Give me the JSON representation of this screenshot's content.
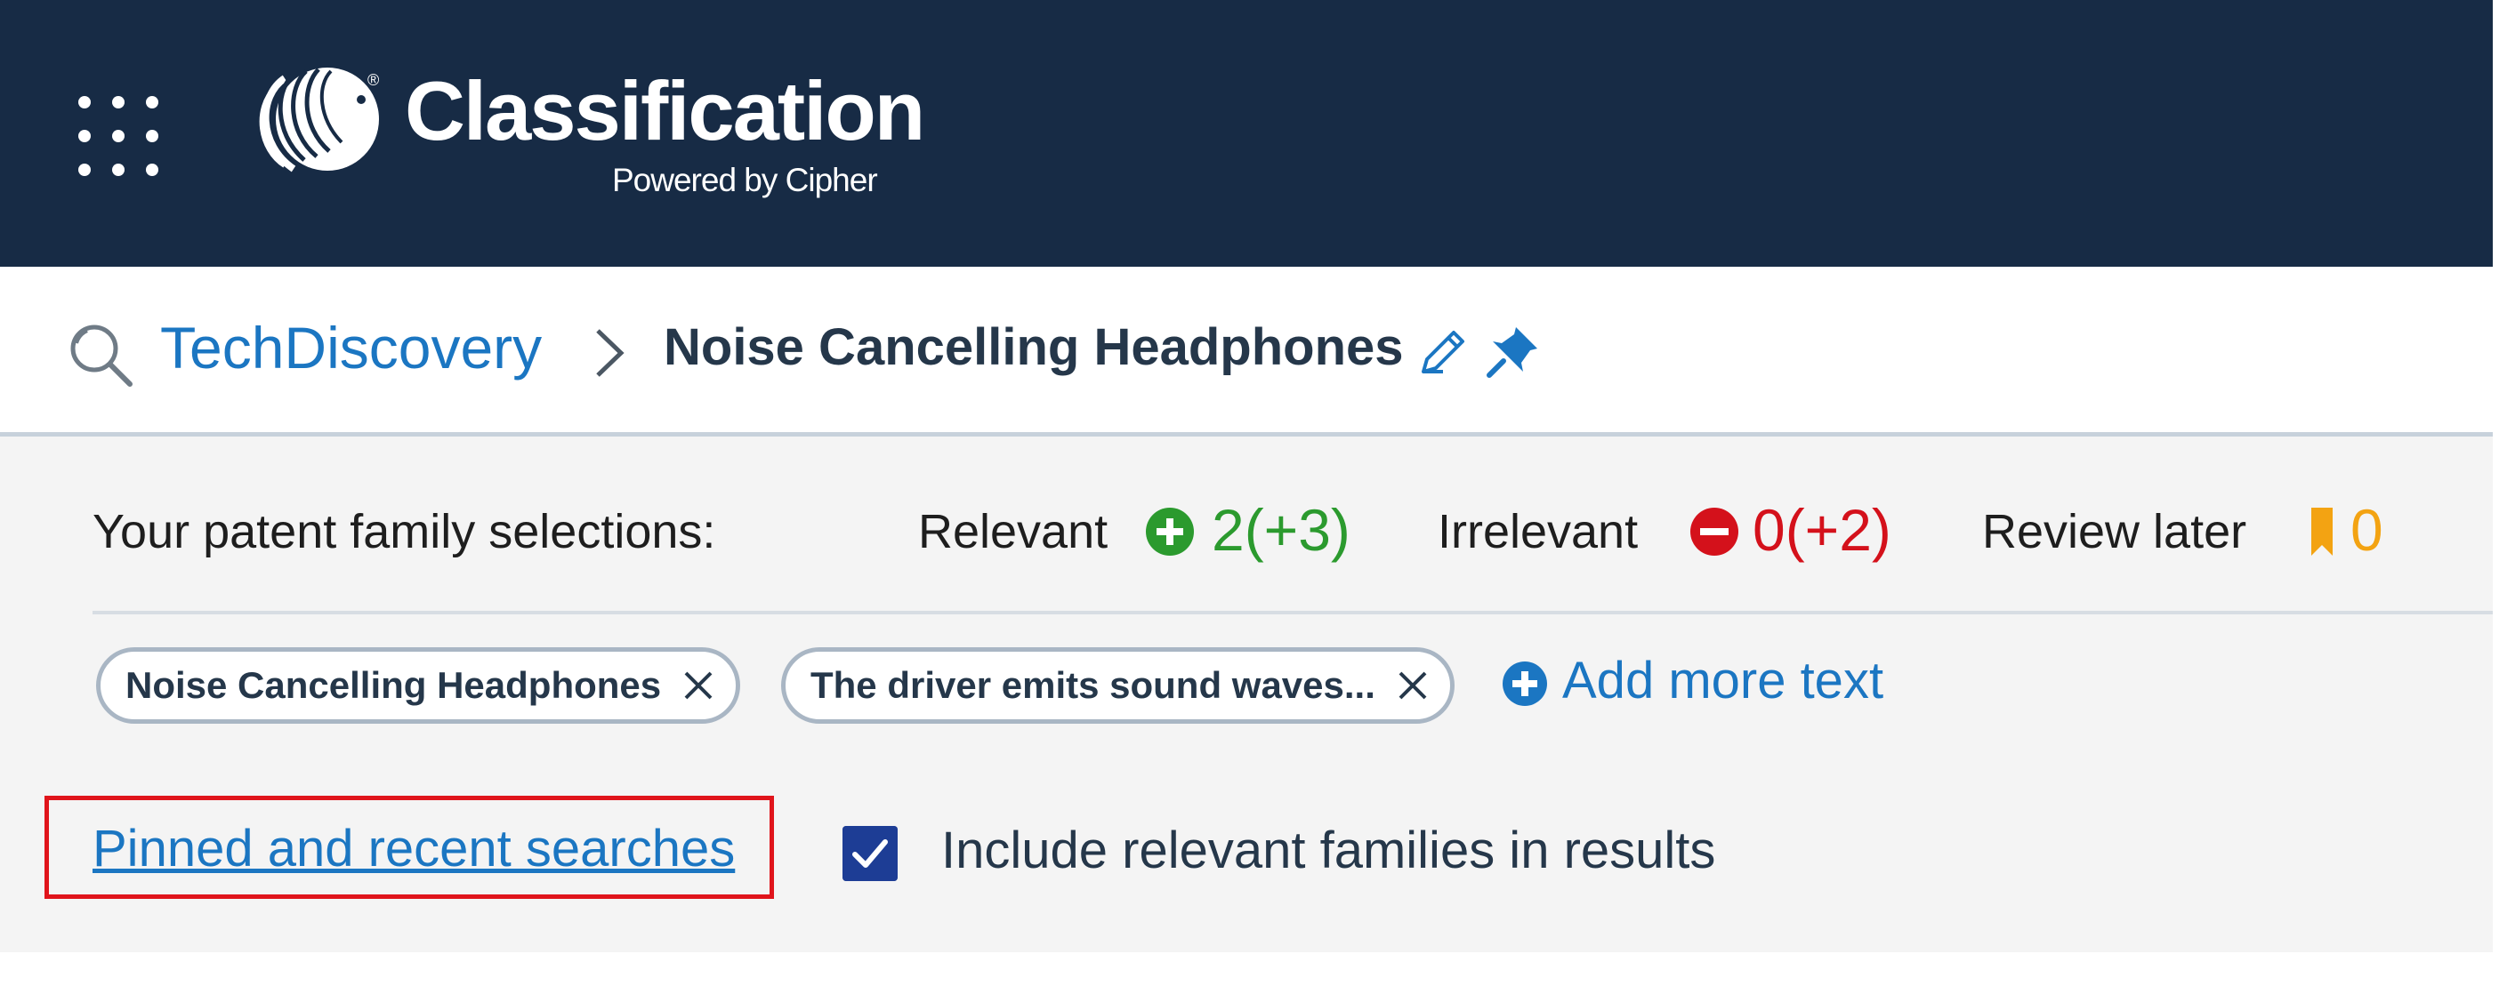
{
  "header": {
    "app_title": "Classification",
    "app_subtitle": "Powered by Cipher",
    "background_color": "#172b45",
    "apps_icon": "grid-dots-icon",
    "logo_icon": "eagle-logo-icon"
  },
  "breadcrumb": {
    "search_icon": "search-icon",
    "root_label": "TechDiscovery",
    "separator_icon": "chevron-right-icon",
    "current_label": "Noise Cancelling Headphones",
    "edit_icon": "pencil-icon",
    "pin_icon": "pin-icon"
  },
  "selections": {
    "label": "Your patent family selections:",
    "relevant": {
      "label": "Relevant",
      "value": "2(+3)",
      "icon": "plus-circle-icon",
      "color": "#2b9a2e"
    },
    "irrelevant": {
      "label": "Irrelevant",
      "value": "0(+2)",
      "icon": "minus-circle-icon",
      "color": "#d4111b"
    },
    "review_later": {
      "label": "Review later",
      "value": "0",
      "icon": "bookmark-icon",
      "color": "#f3a312"
    }
  },
  "chips": [
    {
      "text": "Noise Cancelling Headphones",
      "remove_icon": "close-icon"
    },
    {
      "text": "The driver emits sound waves...",
      "remove_icon": "close-icon"
    }
  ],
  "add_more": {
    "label": "Add more text",
    "icon": "plus-circle-icon"
  },
  "pinned_link": {
    "label": "Pinned and recent searches"
  },
  "include_checkbox": {
    "label": "Include relevant families in results",
    "checked": true
  },
  "colors": {
    "link": "#1b76c2",
    "panel_bg": "#f4f4f4",
    "checkbox": "#1d3d95",
    "highlight": "#e0141b"
  }
}
